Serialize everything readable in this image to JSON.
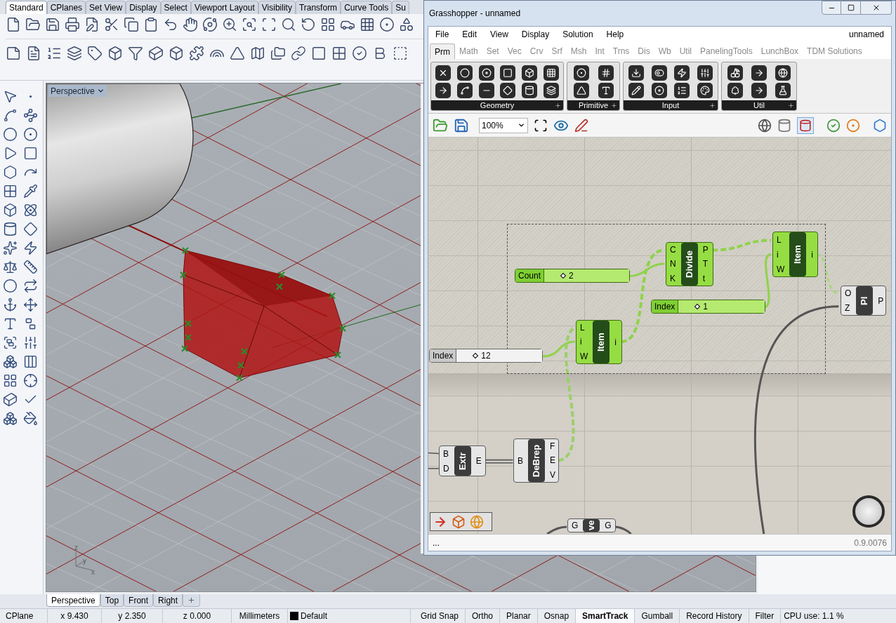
{
  "rhino": {
    "toolbar_tabs": [
      {
        "label": "Standard",
        "selected": true
      },
      {
        "label": "CPlanes",
        "selected": false
      },
      {
        "label": "Set View",
        "selected": false
      },
      {
        "label": "Display",
        "selected": false
      },
      {
        "label": "Select",
        "selected": false
      },
      {
        "label": "Viewport Layout",
        "selected": false
      },
      {
        "label": "Visibility",
        "selected": false
      },
      {
        "label": "Transform",
        "selected": false
      },
      {
        "label": "Curve Tools",
        "selected": false
      },
      {
        "label": "Su",
        "selected": false
      }
    ],
    "viewport": {
      "title": "Perspective",
      "axes": [
        "z",
        "y",
        "x"
      ]
    },
    "viewport_tabs": [
      {
        "label": "Perspective",
        "selected": true
      },
      {
        "label": "Top",
        "selected": false
      },
      {
        "label": "Front",
        "selected": false
      },
      {
        "label": "Right",
        "selected": false
      }
    ],
    "status_bar": {
      "cplane": "CPlane",
      "x": "x 9.430",
      "y": "y 2.350",
      "z": "z 0.000",
      "units": "Millimeters",
      "layer": {
        "name": "Default",
        "color": "#000000"
      },
      "toggles": [
        {
          "label": "Grid Snap",
          "on": false
        },
        {
          "label": "Ortho",
          "on": false
        },
        {
          "label": "Planar",
          "on": false
        },
        {
          "label": "Osnap",
          "on": false
        },
        {
          "label": "SmartTrack",
          "on": true
        },
        {
          "label": "Gumball",
          "on": false
        },
        {
          "label": "Record History",
          "on": false
        },
        {
          "label": "Filter",
          "on": false
        }
      ],
      "cpu": "CPU use: 1.1 %"
    }
  },
  "grasshopper": {
    "title": "Grasshopper - unnamed",
    "menu": [
      "File",
      "Edit",
      "View",
      "Display",
      "Solution",
      "Help"
    ],
    "document": "unnamed",
    "tabs": [
      {
        "label": "Prm",
        "selected": true
      },
      {
        "label": "Math",
        "selected": false
      },
      {
        "label": "Set",
        "selected": false
      },
      {
        "label": "Vec",
        "selected": false
      },
      {
        "label": "Crv",
        "selected": false
      },
      {
        "label": "Srf",
        "selected": false
      },
      {
        "label": "Msh",
        "selected": false
      },
      {
        "label": "Int",
        "selected": false
      },
      {
        "label": "Trns",
        "selected": false
      },
      {
        "label": "Dis",
        "selected": false
      },
      {
        "label": "Wb",
        "selected": false
      },
      {
        "label": "Util",
        "selected": false
      },
      {
        "label": "PanelingTools",
        "selected": false
      },
      {
        "label": "LunchBox",
        "selected": false
      },
      {
        "label": "TDM Solutions",
        "selected": false
      }
    ],
    "groups": [
      "Geometry",
      "Primitive",
      "Input",
      "Util"
    ],
    "zoom": "100%",
    "nodes": [
      {
        "kind": "slider",
        "label": "Count",
        "value": "2",
        "selected": true
      },
      {
        "kind": "component",
        "name": "Divide",
        "inputs": [
          "C",
          "N",
          "K"
        ],
        "outputs": [
          "P",
          "T",
          "t"
        ],
        "selected": true
      },
      {
        "kind": "component",
        "name": "Item",
        "inputs": [
          "L",
          "i",
          "W"
        ],
        "outputs": [
          "i"
        ],
        "selected": true
      },
      {
        "kind": "slider",
        "label": "Index",
        "value": "1",
        "selected": true
      },
      {
        "kind": "component",
        "name": "Item",
        "inputs": [
          "L",
          "i",
          "W"
        ],
        "outputs": [
          "i"
        ],
        "selected": true
      },
      {
        "kind": "slider",
        "label": "Index",
        "value": "12",
        "selected": false
      },
      {
        "kind": "component",
        "name": "Pl",
        "inputs": [
          "O",
          "Z"
        ],
        "outputs": [
          "P"
        ],
        "selected": false
      },
      {
        "kind": "component",
        "name": "Extr",
        "inputs": [
          "B",
          "D"
        ],
        "outputs": [
          "E"
        ],
        "selected": false
      },
      {
        "kind": "component",
        "name": "DeBrep",
        "inputs": [
          "B"
        ],
        "outputs": [
          "F",
          "E",
          "V"
        ],
        "selected": false
      },
      {
        "kind": "component",
        "name": "ve",
        "inputs": [
          "G"
        ],
        "outputs": [
          "G"
        ],
        "selected": false
      }
    ],
    "status": "...",
    "version": "0.9.0076"
  }
}
